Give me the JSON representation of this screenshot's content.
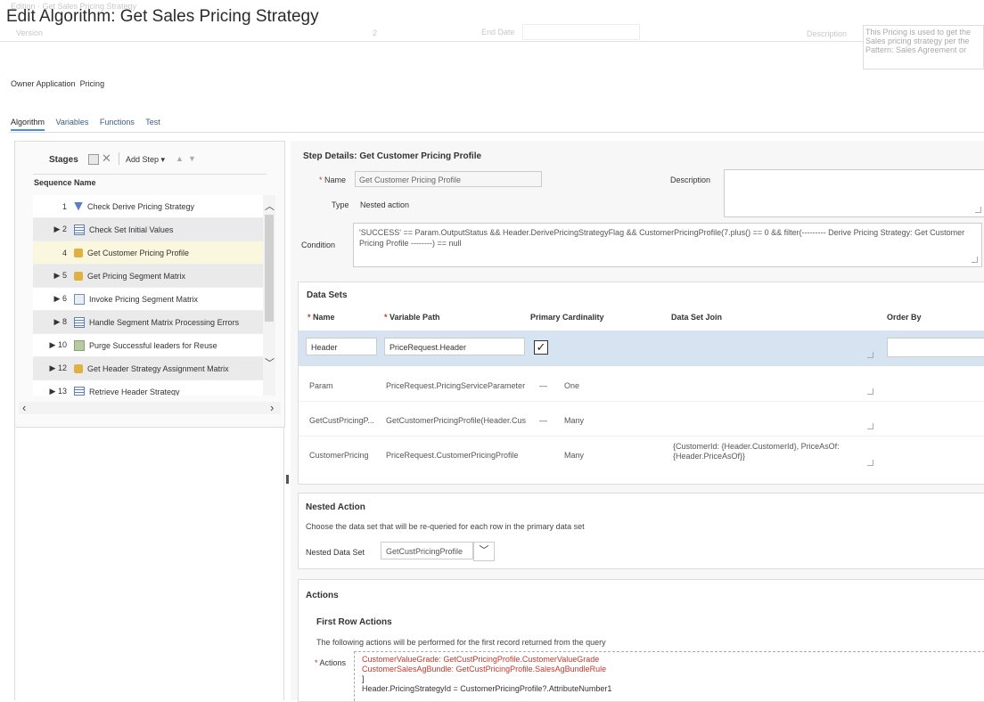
{
  "page": {
    "title": "Edit Algorithm: Get Sales Pricing Strategy",
    "faint_top": {
      "version_label": "Version",
      "version_value": "2",
      "end_date_label": "End Date",
      "description_label": "Description",
      "description_value": "This Pricing is used to get the Sales pricing strategy per the",
      "description_value2": "Pattern: Sales Agreement or"
    },
    "owner_application_label": "Owner Application",
    "owner_application_value": "Pricing"
  },
  "tabs": [
    "Algorithm",
    "Variables",
    "Functions",
    "Test"
  ],
  "stages": {
    "title": "Stages",
    "add_step": "Add Step ▾",
    "col_sequence": "Sequence",
    "col_name": "Name",
    "rows": [
      {
        "seq": "1",
        "expand": "",
        "name": "Check Derive Pricing Strategy",
        "icon": "filter-icon"
      },
      {
        "seq": "2",
        "expand": "▶",
        "name": "Check Set Initial Values",
        "icon": "table-icon"
      },
      {
        "seq": "4",
        "expand": "",
        "name": "Get Customer Pricing Profile",
        "icon": "lookup-icon"
      },
      {
        "seq": "5",
        "expand": "▶",
        "name": "Get Pricing Segment Matrix",
        "icon": "lookup-icon"
      },
      {
        "seq": "6",
        "expand": "▶",
        "name": "Invoke Pricing Segment Matrix",
        "icon": "invoke-icon"
      },
      {
        "seq": "8",
        "expand": "▶",
        "name": "Handle Segment Matrix Processing Errors",
        "icon": "table-icon"
      },
      {
        "seq": "10",
        "expand": "▶",
        "name": "Purge Successful leaders for Reuse",
        "icon": "purge-icon"
      },
      {
        "seq": "12",
        "expand": "▶",
        "name": "Get Header Strategy Assignment Matrix",
        "icon": "lookup-icon"
      },
      {
        "seq": "13",
        "expand": "▶",
        "name": "Retrieve Header Strategy",
        "icon": "table-icon"
      }
    ]
  },
  "step_details": {
    "title": "Step Details: Get Customer Pricing Profile",
    "name_label": "Name",
    "name_value": "Get Customer Pricing Profile",
    "description_label": "Description",
    "type_label": "Type",
    "type_value": "Nested action",
    "condition_label": "Condition",
    "condition_value": "'SUCCESS' == Param.OutputStatus && Header.DerivePricingStrategyFlag && CustomerPricingProfile(7.plus() == 0 && filter(--------- Derive Pricing Strategy: Get Customer Pricing Profile --------) == null"
  },
  "data_sets": {
    "title": "Data Sets",
    "columns": [
      "Name",
      "Variable Path",
      "Primary",
      "Cardinality",
      "Data Set Join",
      "Order By"
    ],
    "rows": [
      {
        "name": "Header",
        "path": "PriceRequest.Header",
        "primary": "✓",
        "cardinality": "",
        "join": "",
        "order": ""
      },
      {
        "name": "Param",
        "path": "PriceRequest.PricingServiceParameter",
        "primary": "—",
        "cardinality": "One",
        "join": "",
        "order": ""
      },
      {
        "name": "GetCustPricingP...",
        "path": "GetCustomerPricingProfile(Header.Cus",
        "primary": "—",
        "cardinality": "Many",
        "join": "",
        "order": ""
      },
      {
        "name": "CustomerPricing",
        "path": "PriceRequest.CustomerPricingProfile",
        "primary": "",
        "cardinality": "Many",
        "join": "{CustomerId: {Header.CustomerId}, PriceAsOf: {Header.PriceAsOf}}",
        "order": ""
      }
    ]
  },
  "nested_action": {
    "title": "Nested Action",
    "description": "Choose the data set that will be re-queried for each row in the primary data set",
    "label": "Nested Data Set",
    "value": "GetCustPricingProfile"
  },
  "actions": {
    "title": "Actions",
    "first_row_title": "First Row Actions",
    "description": "The following actions will be performed for the first record returned from the query",
    "label": "Actions",
    "code_line1": "CustomerValueGrade: GetCustPricingProfile.CustomerValueGrade",
    "code_line2": "CustomerSalesAgBundle: GetCustPricingProfile.SalesAgBundleRule",
    "code_line3": "]",
    "code_line4": "Header.PricingStrategyId = CustomerPricingProfile?.AttributeNumber1"
  }
}
